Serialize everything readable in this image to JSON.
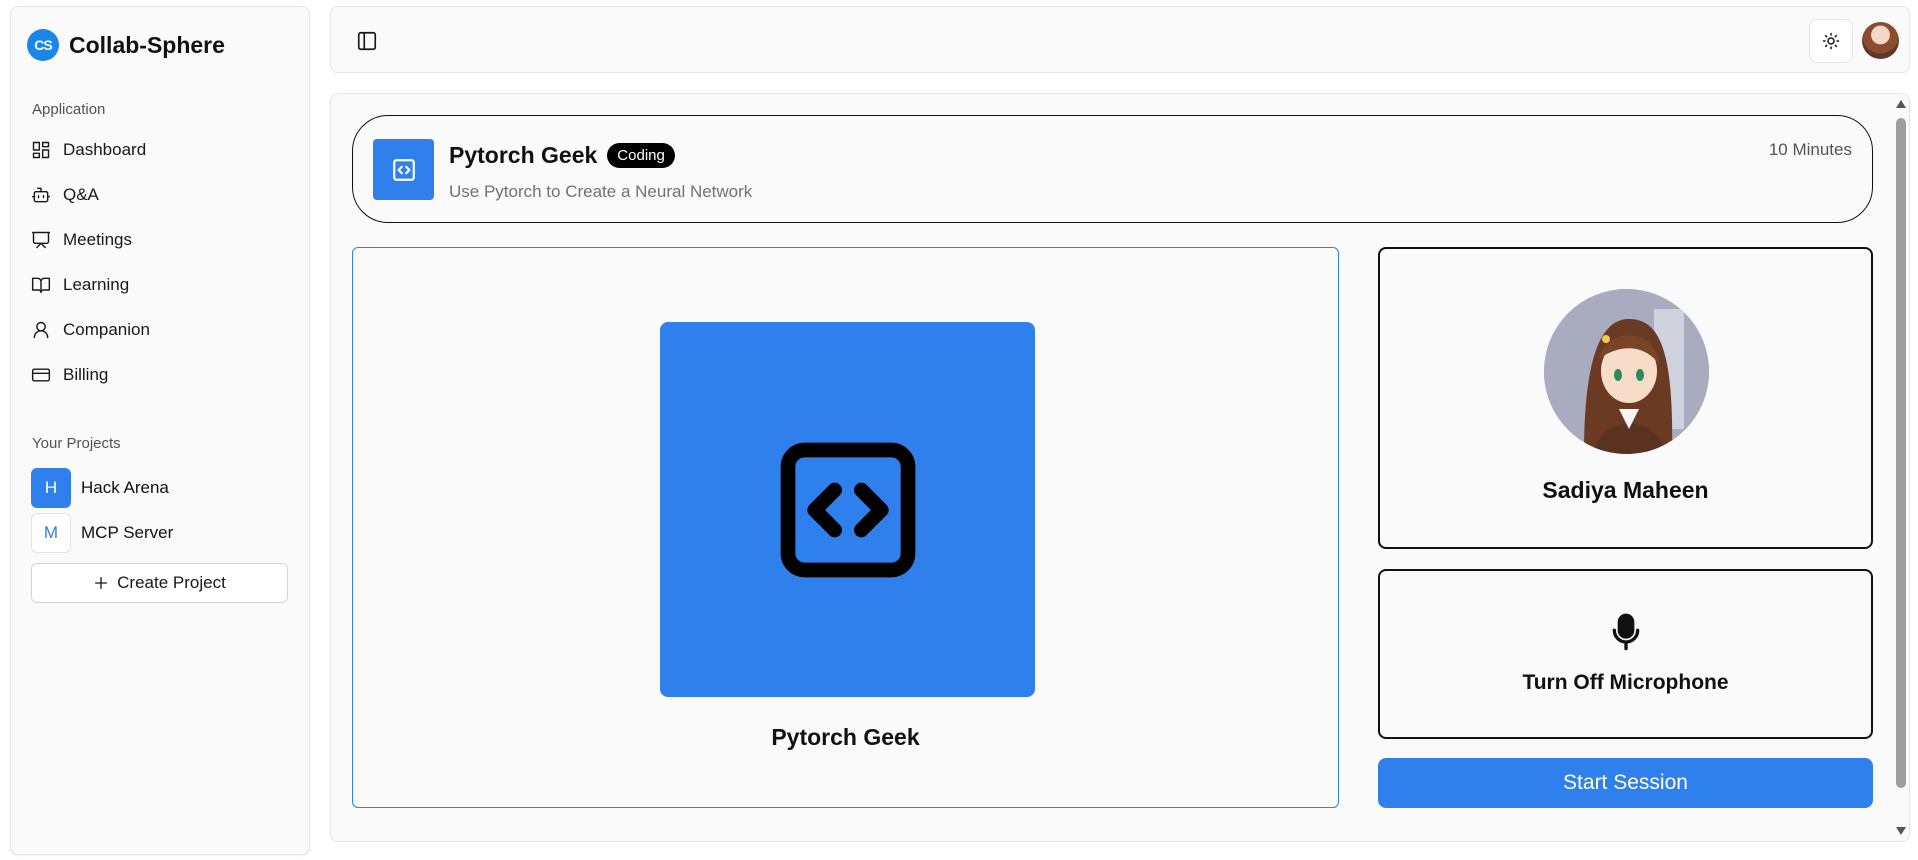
{
  "brand": {
    "logo_text": "CS",
    "name": "Collab-Sphere",
    "logo_color": "#1a86e8"
  },
  "sidebar": {
    "application_label": "Application",
    "nav_items": [
      {
        "label": "Dashboard",
        "icon": "dashboard-icon"
      },
      {
        "label": "Q&A",
        "icon": "bot-icon"
      },
      {
        "label": "Meetings",
        "icon": "presentation-icon"
      },
      {
        "label": "Learning",
        "icon": "book-icon"
      },
      {
        "label": "Companion",
        "icon": "user-icon"
      },
      {
        "label": "Billing",
        "icon": "credit-card-icon"
      }
    ],
    "projects_label": "Your Projects",
    "projects": [
      {
        "initial": "H",
        "name": "Hack Arena"
      },
      {
        "initial": "M",
        "name": "MCP Server"
      }
    ],
    "create_project_label": "Create Project"
  },
  "topbar": {
    "toggle_icon": "sidebar-toggle-icon",
    "theme_icon": "sun-icon",
    "avatar_icon": "user-avatar"
  },
  "session": {
    "companion_name": "Pytorch Geek",
    "subject_tag": "Coding",
    "topic": "Use Pytorch to Create a Neural Network",
    "duration": "10 Minutes",
    "accent_color": "#2f80ed"
  },
  "user": {
    "name": "Sadiya Maheen"
  },
  "controls": {
    "mic_label": "Turn Off Microphone",
    "start_label": "Start Session"
  }
}
